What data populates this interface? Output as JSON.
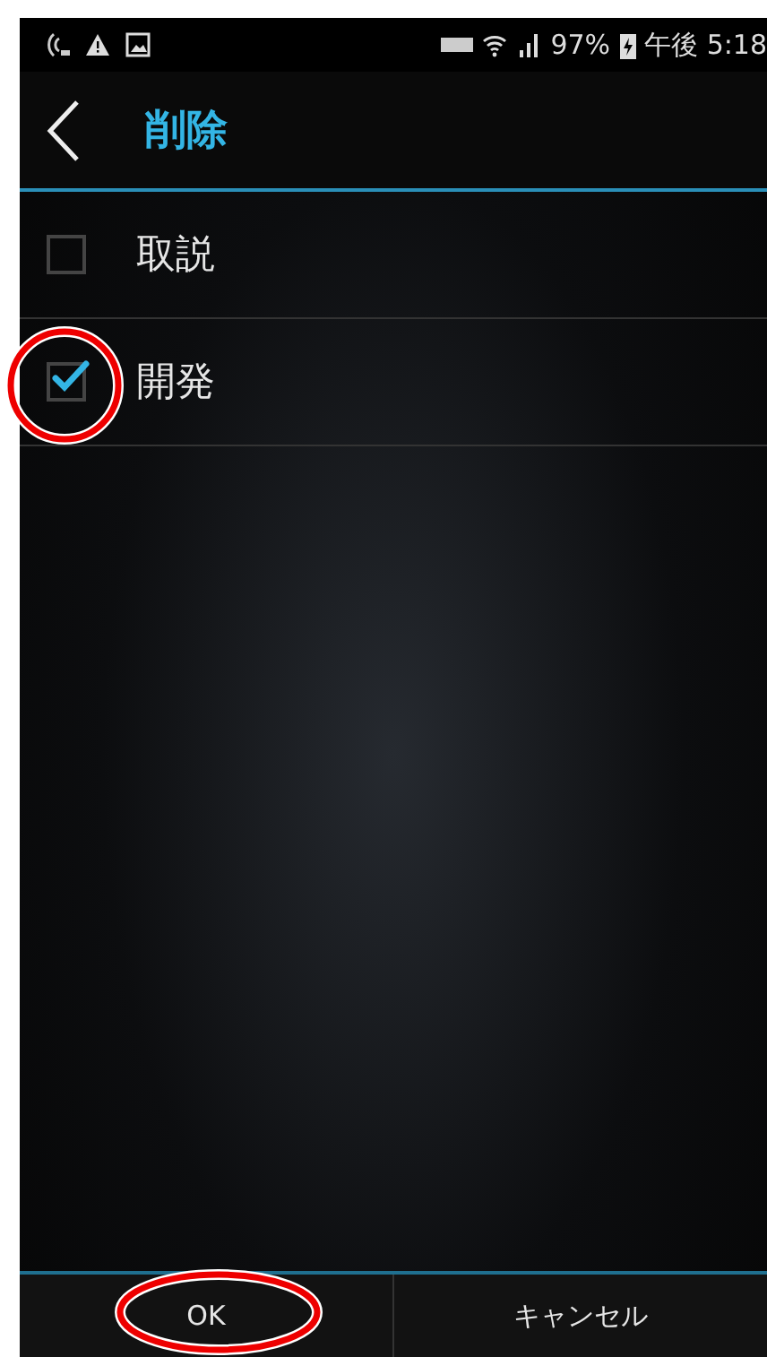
{
  "status_bar": {
    "battery": "97%",
    "time": "午後 5:18"
  },
  "header": {
    "title": "削除"
  },
  "items": [
    {
      "label": "取説",
      "checked": false
    },
    {
      "label": "開発",
      "checked": true
    }
  ],
  "buttons": [
    {
      "label": "OK"
    },
    {
      "label": "キャンセル"
    }
  ]
}
